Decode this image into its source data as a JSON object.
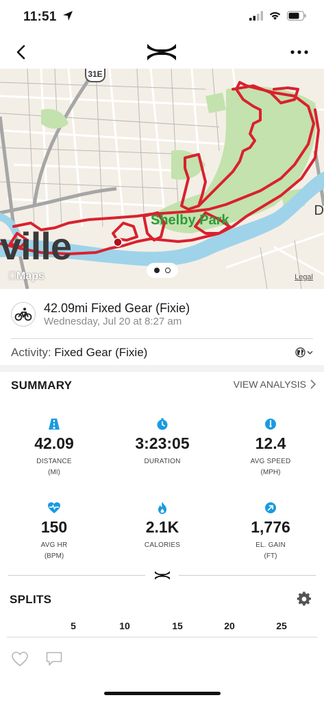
{
  "status_bar": {
    "time": "11:51"
  },
  "nav": {
    "back_icon": "chevron-left-icon",
    "logo": "under-armour-logo",
    "more_icon": "more-horizontal-icon"
  },
  "map": {
    "city_label": "ville",
    "park_label": "Shelby Park",
    "edge_label": "D",
    "route_shield": "31E",
    "attribution": "Maps",
    "legal_link": "Legal",
    "route_color": "#d9212e",
    "water_color": "#9fd3ea",
    "park_color": "#c3e2ad",
    "pager": {
      "pages": 2,
      "active": 1
    }
  },
  "workout": {
    "title": "42.09mi Fixed Gear (Fixie)",
    "date": "Wednesday, Jul 20 at 8:27 am",
    "icon": "bicycle-icon"
  },
  "activity": {
    "label": "Activity:",
    "value": "Fixed Gear (Fixie)",
    "privacy_icon": "globe-icon"
  },
  "summary": {
    "title": "SUMMARY",
    "view_analysis": "VIEW ANALYSIS",
    "accent_color": "#1a9be0",
    "stats": [
      {
        "icon": "road-icon",
        "value": "42.09",
        "label": "DISTANCE",
        "unit": "(MI)"
      },
      {
        "icon": "stopwatch-icon",
        "value": "3:23:05",
        "label": "DURATION",
        "unit": ""
      },
      {
        "icon": "speedometer-icon",
        "value": "12.4",
        "label": "AVG SPEED",
        "unit": "(MPH)"
      },
      {
        "icon": "heart-rate-icon",
        "value": "150",
        "label": "AVG HR",
        "unit": "(BPM)"
      },
      {
        "icon": "flame-icon",
        "value": "2.1K",
        "label": "CALORIES",
        "unit": ""
      },
      {
        "icon": "elevation-arrow-icon",
        "value": "1,776",
        "label": "EL. GAIN",
        "unit": "(FT)"
      }
    ]
  },
  "splits": {
    "title": "SPLITS",
    "settings_icon": "gear-icon",
    "axis_ticks": [
      "5",
      "10",
      "15",
      "20",
      "25"
    ]
  },
  "social": {
    "like_icon": "heart-outline-icon",
    "comment_icon": "comment-icon"
  }
}
